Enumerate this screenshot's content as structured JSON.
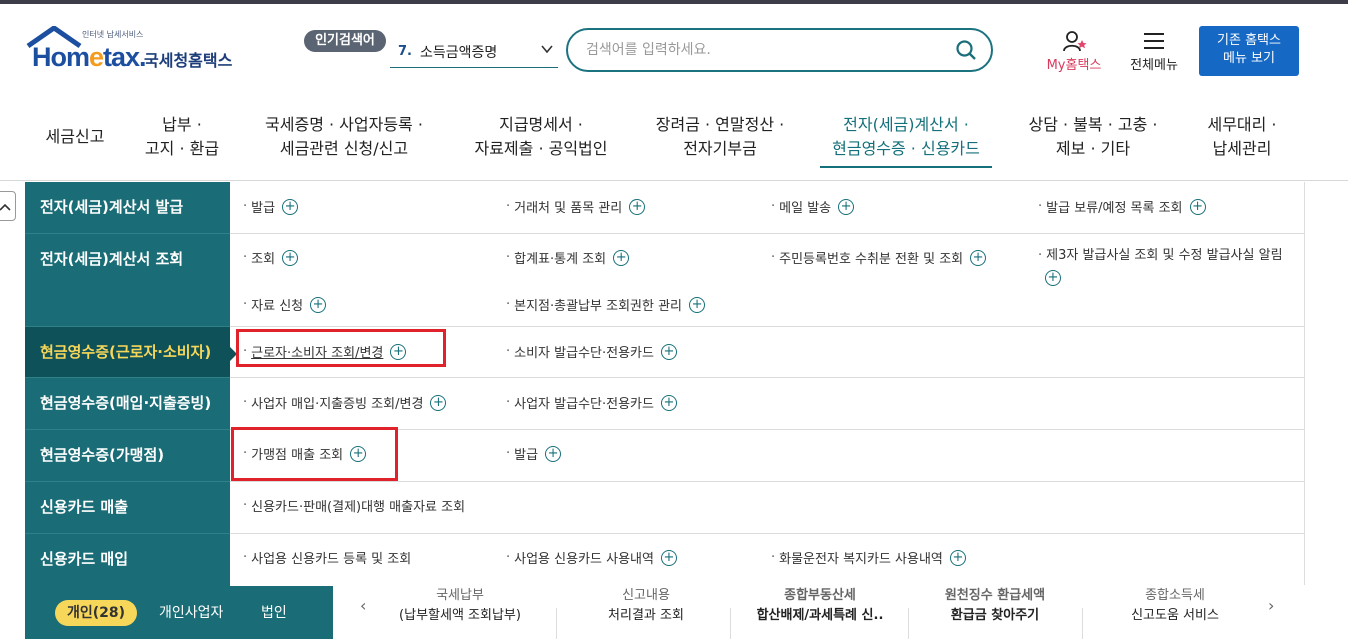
{
  "header": {
    "logo_small": "인터넷 납세서비스",
    "logo_word_a": "Hom",
    "logo_word_e": "e",
    "logo_word_b": "tax.",
    "logo_kr": "국세청홈택스",
    "popular_badge": "인기검색어",
    "popular_rank": "7.",
    "popular_term": "소득금액증명",
    "search_placeholder": "검색어를 입력하세요.",
    "my_hometax": "My홈택스",
    "all_menu": "전체메뉴",
    "legacy_line1": "기존 홈택스",
    "legacy_line2": "메뉴 보기"
  },
  "gnb": [
    {
      "l1": "세금신고",
      "l2": ""
    },
    {
      "l1": "납부 ·",
      "l2": "고지 · 환급"
    },
    {
      "l1": "국세증명 · 사업자등록 ·",
      "l2": "세금관련 신청/신고"
    },
    {
      "l1": "지급명세서 ·",
      "l2": "자료제출 · 공익법인"
    },
    {
      "l1": "장려금 · 연말정산 ·",
      "l2": "전자기부금"
    },
    {
      "l1": "전자(세금)계산서 ·",
      "l2": "현금영수증 · 신용카드"
    },
    {
      "l1": "상담 · 불복 · 고충 ·",
      "l2": "제보 · 기타"
    },
    {
      "l1": "세무대리 ·",
      "l2": "납세관리"
    }
  ],
  "side": [
    "전자(세금)계산서 발급",
    "전자(세금)계산서 조회",
    "현금영수증(근로자·소비자)",
    "현금영수증(매입·지출증빙)",
    "현금영수증(가맹점)",
    "신용카드 매출",
    "신용카드 매입"
  ],
  "links": {
    "r1": [
      "발급",
      "거래처 및 품목 관리",
      "메일 발송",
      "발급 보류/예정 목록 조회"
    ],
    "r2": [
      "조회",
      "합계표·통계 조회",
      "주민등록번호 수취분 전환 및 조회",
      "제3자 발급사실 조회 및 수정 발급사실 알림"
    ],
    "r2b": [
      "자료 신청",
      "본지점·총괄납부 조회권한 관리"
    ],
    "r3": [
      "근로자·소비자 조회/변경",
      "소비자 발급수단·전용카드"
    ],
    "r4": [
      "사업자 매입·지출증빙 조회/변경",
      "사업자 발급수단·전용카드"
    ],
    "r5": [
      "가맹점 매출 조회",
      "발급"
    ],
    "r6": [
      "신용카드·판매(결제)대행 매출자료 조회"
    ],
    "r7": [
      "사업용 신용카드 등록 및 조회",
      "사업용 신용카드 사용내역",
      "화물운전자 복지카드 사용내역"
    ]
  },
  "bottom": {
    "tabs": [
      "개인(28)",
      "개인사업자",
      "법인"
    ],
    "quick": [
      {
        "t1": "국세납부",
        "t2": "(납부할세액 조회납부)"
      },
      {
        "t1": "신고내용",
        "t2": "처리결과 조회"
      },
      {
        "t1": "종합부동산세",
        "t2": "합산배제/과세특례 신.."
      },
      {
        "t1": "원천징수 환급세액",
        "t2": "환급금 찾아주기"
      },
      {
        "t1": "종합소득세",
        "t2": "신고도움 서비스"
      }
    ]
  },
  "colors": {
    "teal": "#1a6d76",
    "teal_dark": "#0e5159",
    "highlight_yellow": "#f7d75a",
    "legacy_blue": "#1568c4",
    "alert_red": "#e0232a"
  }
}
